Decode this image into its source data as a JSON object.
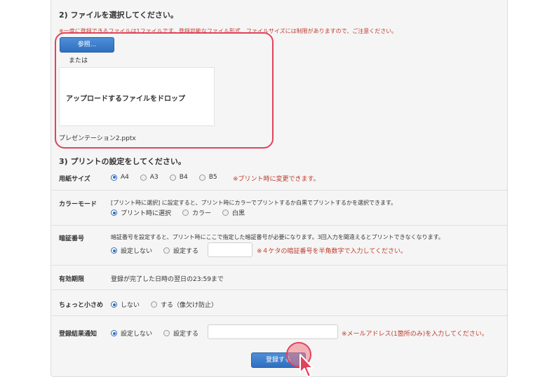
{
  "step2": {
    "heading": "2) ファイルを選択してください。",
    "note": "※一度に登録できるファイルは1ファイルです。登録可能なファイル形式、ファイルサイズには制限がありますので、ご注意ください。",
    "browse_label": "参照...",
    "or_text": "または",
    "drop_text": "アップロードするファイルをドロップ",
    "file_name": "プレゼンテーション2.pptx"
  },
  "step3": {
    "heading": "3) プリントの設定をしてください。"
  },
  "paper_size": {
    "label": "用紙サイズ",
    "options": [
      "A4",
      "A3",
      "B4",
      "B5"
    ],
    "selected": "A4",
    "note": "※プリント時に変更できます。"
  },
  "color_mode": {
    "label": "カラーモード",
    "description": "[プリント時に選択] に設定すると、プリント時にカラーでプリントするか白黒でプリントするかを選択できます。",
    "options": [
      "プリント時に選択",
      "カラー",
      "白黒"
    ],
    "selected": "プリント時に選択"
  },
  "pin": {
    "label": "暗証番号",
    "description": "暗証番号を設定すると、プリント時にここで指定した暗証番号が必要になります。3回入力を間違えるとプリントできなくなります。",
    "options": [
      "設定しない",
      "設定する"
    ],
    "selected": "設定しない",
    "input_value": "",
    "note": "※４ケタの暗証番号を半角数字で入力してください。"
  },
  "expiry": {
    "label": "有効期限",
    "value": "登録が完了した日時の翌日の23:59まで"
  },
  "smaller": {
    "label": "ちょっと小さめ",
    "options": [
      "しない",
      "する（像欠け防止）"
    ],
    "selected": "しない"
  },
  "notify": {
    "label": "登録結果通知",
    "options": [
      "設定しない",
      "設定する"
    ],
    "selected": "設定しない",
    "input_value": "",
    "note": "※メールアドレス(1箇所のみ)を入力してください。"
  },
  "submit_label": "登録する",
  "colors": {
    "accent_blue": "#2f6fbf",
    "note_red": "#c0392b",
    "highlight_pink": "#e0435e"
  }
}
